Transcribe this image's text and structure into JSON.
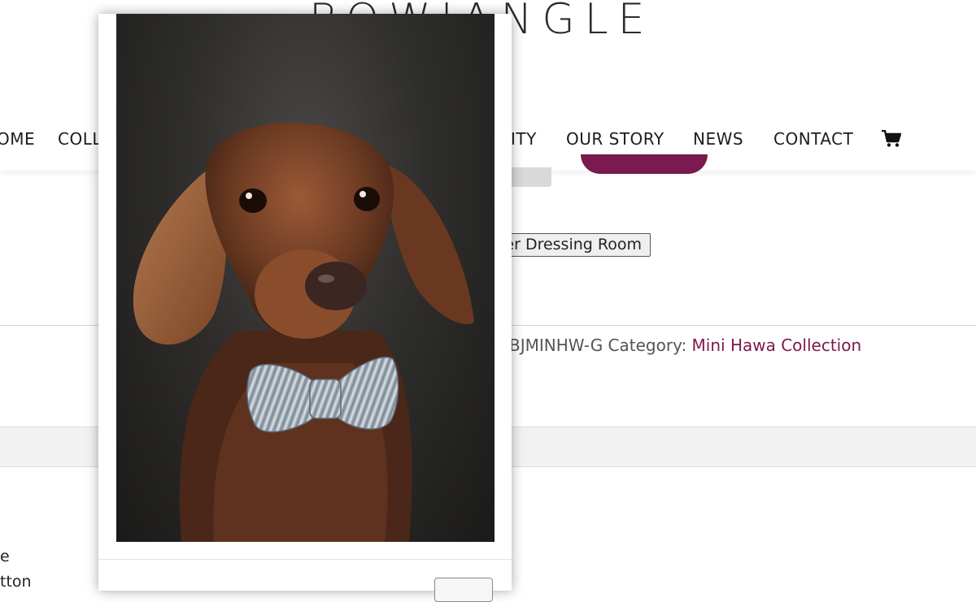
{
  "header": {
    "logo_text": "BOWJANGLE"
  },
  "nav": {
    "items": [
      {
        "label": "HOME",
        "visible": "OME"
      },
      {
        "label": "COLL",
        "visible": "COLL"
      },
      {
        "label": "ITY",
        "visible": "ITY"
      },
      {
        "label": "OUR STORY",
        "visible": "OUR STORY"
      },
      {
        "label": "NEWS",
        "visible": "NEWS"
      },
      {
        "label": "CONTACT",
        "visible": "CONTACT"
      }
    ],
    "cart_icon": "shopping-cart-icon"
  },
  "product": {
    "dressing_room_label": "er Dressing Room",
    "sku_text": "BJMINHW-G",
    "category_label": "Category:",
    "category_value": "Mini Hawa Collection",
    "left_text_1": "e",
    "left_text_2": "tton"
  },
  "modal": {
    "image_subject": "dachshund-with-bowtie-photo"
  },
  "colors": {
    "accent": "#7a1a4f",
    "background": "#ffffff",
    "band": "#f2f2f2"
  }
}
